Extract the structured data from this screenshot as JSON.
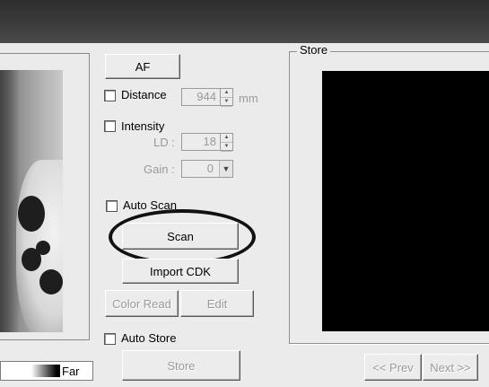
{
  "preview": {
    "range_label": "Far"
  },
  "controls": {
    "af_label": "AF",
    "distance_label": "Distance",
    "distance_value": "944",
    "distance_unit": "mm",
    "intensity_label": "Intensity",
    "ld_label": "LD :",
    "ld_value": "18",
    "gain_label": "Gain :",
    "gain_value": "0",
    "auto_scan_label": "Auto Scan",
    "scan_label": "Scan",
    "import_cdk_label": "Import CDK",
    "color_read_label": "Color Read",
    "edit_label": "Edit",
    "auto_store_label": "Auto Store",
    "store_button_label": "Store"
  },
  "store_panel": {
    "title": "Store",
    "prev_label": "<< Prev",
    "next_label": "Next >>"
  },
  "colors": {
    "titlebar": "#3a3a3a",
    "store_screen": "#000000",
    "background": "#ebebeb"
  }
}
